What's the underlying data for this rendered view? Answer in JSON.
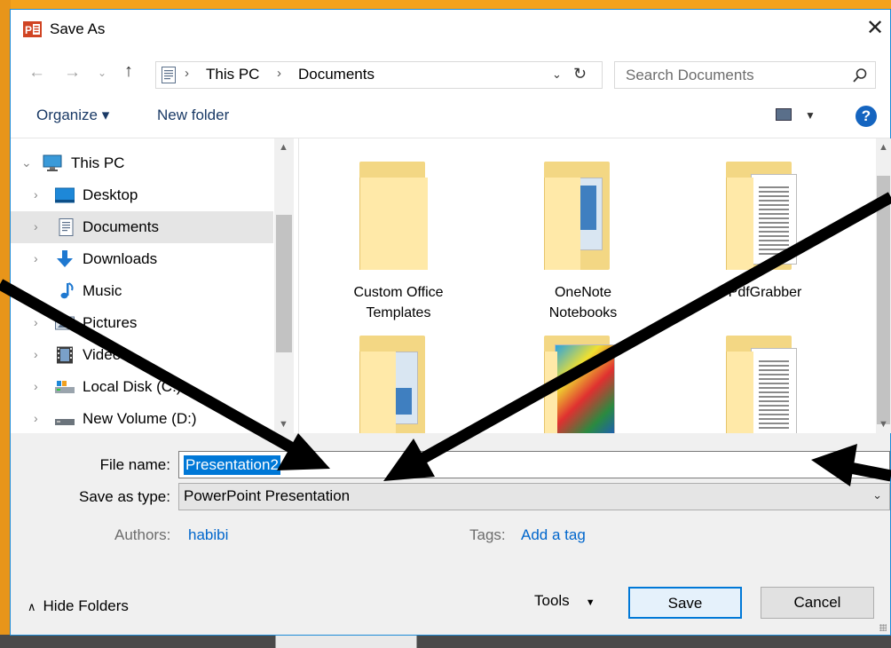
{
  "window": {
    "title": "Save As",
    "close_glyph": "✕"
  },
  "address": {
    "segments": [
      "This PC",
      "Documents"
    ],
    "search_placeholder": "Search Documents"
  },
  "toolbar": {
    "organize": "Organize ▾",
    "new_folder": "New folder",
    "help": "?"
  },
  "nav": {
    "items": [
      {
        "label": "This PC",
        "icon": "pc-icon",
        "expanded": true
      },
      {
        "label": "Desktop",
        "icon": "desktop-icon"
      },
      {
        "label": "Documents",
        "icon": "documents-icon",
        "selected": true
      },
      {
        "label": "Downloads",
        "icon": "downloads-icon"
      },
      {
        "label": "Music",
        "icon": "music-icon"
      },
      {
        "label": "Pictures",
        "icon": "pictures-icon"
      },
      {
        "label": "Videos",
        "icon": "videos-icon"
      },
      {
        "label": "Local Disk (C:)",
        "icon": "local-disk-icon"
      },
      {
        "label": "New Volume (D:)",
        "icon": "drive-icon"
      }
    ]
  },
  "files": [
    {
      "name_line1": "Custom Office",
      "name_line2": "Templates",
      "icon": "folder-icon"
    },
    {
      "name_line1": "OneNote",
      "name_line2": "Notebooks",
      "icon": "folder-icon"
    },
    {
      "name_line1": "PdfGrabber",
      "name_line2": "",
      "icon": "folder-icon"
    },
    {
      "name_line1": "",
      "name_line2": "",
      "icon": "folder-icon"
    },
    {
      "name_line1": "",
      "name_line2": "",
      "icon": "folder-icon"
    },
    {
      "name_line1": "",
      "name_line2": "",
      "icon": "folder-icon"
    }
  ],
  "form": {
    "file_name_label": "File name:",
    "file_name_value": "Presentation2",
    "save_as_type_label": "Save as type:",
    "save_as_type_value": "PowerPoint Presentation",
    "authors_label": "Authors:",
    "authors_value": "habibi",
    "tags_label": "Tags:",
    "tags_value": "Add a tag"
  },
  "footer": {
    "hide_folders": "Hide Folders",
    "tools": "Tools",
    "save": "Save",
    "cancel": "Cancel"
  },
  "colors": {
    "accent": "#0078d7",
    "background": "#f4a21c",
    "link": "#0066cc"
  }
}
